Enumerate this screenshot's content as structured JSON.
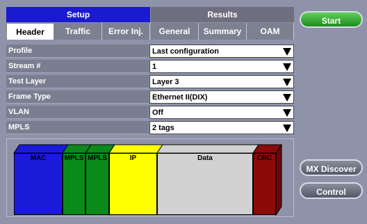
{
  "modes": {
    "setup": "Setup",
    "results": "Results"
  },
  "subtabs": [
    "Header",
    "Traffic",
    "Error Inj.",
    "General",
    "Summary",
    "OAM"
  ],
  "rows": [
    {
      "label": "Profile",
      "value": "Last configuration"
    },
    {
      "label": "Stream #",
      "value": "1"
    },
    {
      "label": "Test Layer",
      "value": "Layer 3"
    },
    {
      "label": "Frame Type",
      "value": "Ethernet II(DIX)"
    },
    {
      "label": "VLAN",
      "value": "Off"
    },
    {
      "label": "MPLS",
      "value": "2 tags"
    }
  ],
  "frame": {
    "blocks": [
      {
        "label": "MAC",
        "color": "#1a1ad8",
        "top": "#1a1ad8"
      },
      {
        "label": "MPLS",
        "color": "#0a8a1a",
        "top": "#0a8a1a"
      },
      {
        "label": "MPLS",
        "color": "#0a8a1a",
        "top": "#0a8a1a"
      },
      {
        "label": "IP",
        "color": "#ffff00",
        "top": "#ffff00"
      },
      {
        "label": "Data",
        "color": "#d2d2d2",
        "top": "#d2d2d2"
      },
      {
        "label": "CRC",
        "color": "#8b0a0a",
        "top": "#8b0a0a"
      }
    ]
  },
  "buttons": {
    "start": "Start",
    "mx_discover": "MX Discover",
    "control": "Control"
  }
}
